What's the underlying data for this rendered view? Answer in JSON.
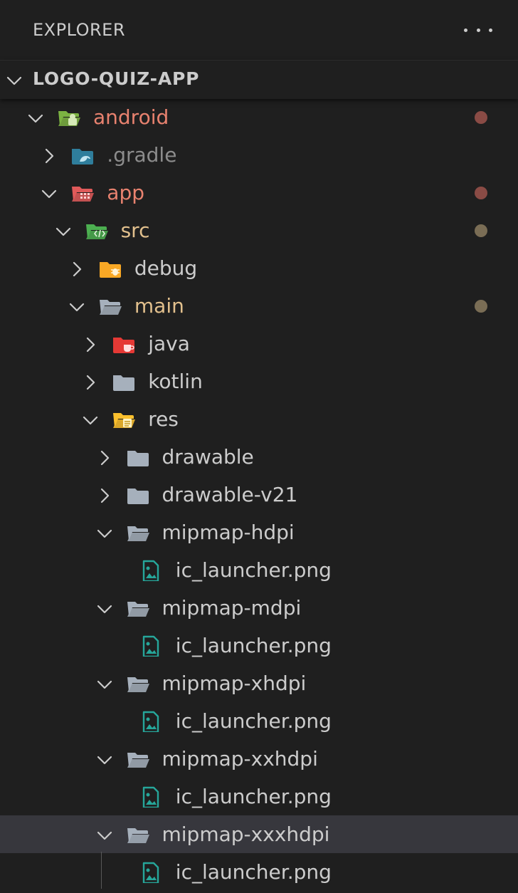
{
  "panel": {
    "title": "EXPLORER",
    "more_icon": "ellipsis-icon"
  },
  "section": {
    "label": "LOGO-QUIZ-APP",
    "expanded": true
  },
  "colors": {
    "background": "#1f1f1f",
    "selected_row": "#37373d",
    "modified_red": "#e8826f",
    "modified_yellow": "#e2c08d",
    "ignored_gray": "#8c8c8c",
    "default_text": "#cccccc",
    "dot_red": "#8a4b45",
    "dot_yellow": "#7a6d55"
  },
  "tree": [
    {
      "name": "android",
      "depth": 0,
      "chevron": "down",
      "icon": "android-folder-icon",
      "color": "#e8826f",
      "dot": "#8a4b45"
    },
    {
      "name": ".gradle",
      "depth": 1,
      "chevron": "right",
      "icon": "gradle-folder-icon",
      "color": "#8c8c8c",
      "dot": null
    },
    {
      "name": "app",
      "depth": 1,
      "chevron": "down",
      "icon": "app-folder-icon",
      "color": "#e8826f",
      "dot": "#8a4b45"
    },
    {
      "name": "src",
      "depth": 2,
      "chevron": "down",
      "icon": "src-folder-icon",
      "color": "#e2c08d",
      "dot": "#7a6d55"
    },
    {
      "name": "debug",
      "depth": 3,
      "chevron": "right",
      "icon": "debug-folder-icon",
      "color": "#cccccc",
      "dot": null
    },
    {
      "name": "main",
      "depth": 3,
      "chevron": "down",
      "icon": "folder-open-icon",
      "color": "#e2c08d",
      "dot": "#7a6d55"
    },
    {
      "name": "java",
      "depth": 4,
      "chevron": "right",
      "icon": "java-folder-icon",
      "color": "#cccccc",
      "dot": null
    },
    {
      "name": "kotlin",
      "depth": 4,
      "chevron": "right",
      "icon": "folder-icon",
      "color": "#cccccc",
      "dot": null
    },
    {
      "name": "res",
      "depth": 4,
      "chevron": "down",
      "icon": "res-folder-icon",
      "color": "#cccccc",
      "dot": null
    },
    {
      "name": "drawable",
      "depth": 5,
      "chevron": "right",
      "icon": "folder-icon",
      "color": "#cccccc",
      "dot": null
    },
    {
      "name": "drawable-v21",
      "depth": 5,
      "chevron": "right",
      "icon": "folder-icon",
      "color": "#cccccc",
      "dot": null
    },
    {
      "name": "mipmap-hdpi",
      "depth": 5,
      "chevron": "down",
      "icon": "folder-open-icon",
      "color": "#cccccc",
      "dot": null
    },
    {
      "name": "ic_launcher.png",
      "depth": 6,
      "chevron": null,
      "icon": "image-file-icon",
      "color": "#cccccc",
      "dot": null
    },
    {
      "name": "mipmap-mdpi",
      "depth": 5,
      "chevron": "down",
      "icon": "folder-open-icon",
      "color": "#cccccc",
      "dot": null
    },
    {
      "name": "ic_launcher.png",
      "depth": 6,
      "chevron": null,
      "icon": "image-file-icon",
      "color": "#cccccc",
      "dot": null
    },
    {
      "name": "mipmap-xhdpi",
      "depth": 5,
      "chevron": "down",
      "icon": "folder-open-icon",
      "color": "#cccccc",
      "dot": null
    },
    {
      "name": "ic_launcher.png",
      "depth": 6,
      "chevron": null,
      "icon": "image-file-icon",
      "color": "#cccccc",
      "dot": null
    },
    {
      "name": "mipmap-xxhdpi",
      "depth": 5,
      "chevron": "down",
      "icon": "folder-open-icon",
      "color": "#cccccc",
      "dot": null
    },
    {
      "name": "ic_launcher.png",
      "depth": 6,
      "chevron": null,
      "icon": "image-file-icon",
      "color": "#cccccc",
      "dot": null
    },
    {
      "name": "mipmap-xxxhdpi",
      "depth": 5,
      "chevron": "down",
      "icon": "folder-open-icon",
      "color": "#cccccc",
      "dot": null,
      "selected": true
    },
    {
      "name": "ic_launcher.png",
      "depth": 6,
      "chevron": null,
      "icon": "image-file-icon",
      "color": "#cccccc",
      "dot": null
    }
  ]
}
